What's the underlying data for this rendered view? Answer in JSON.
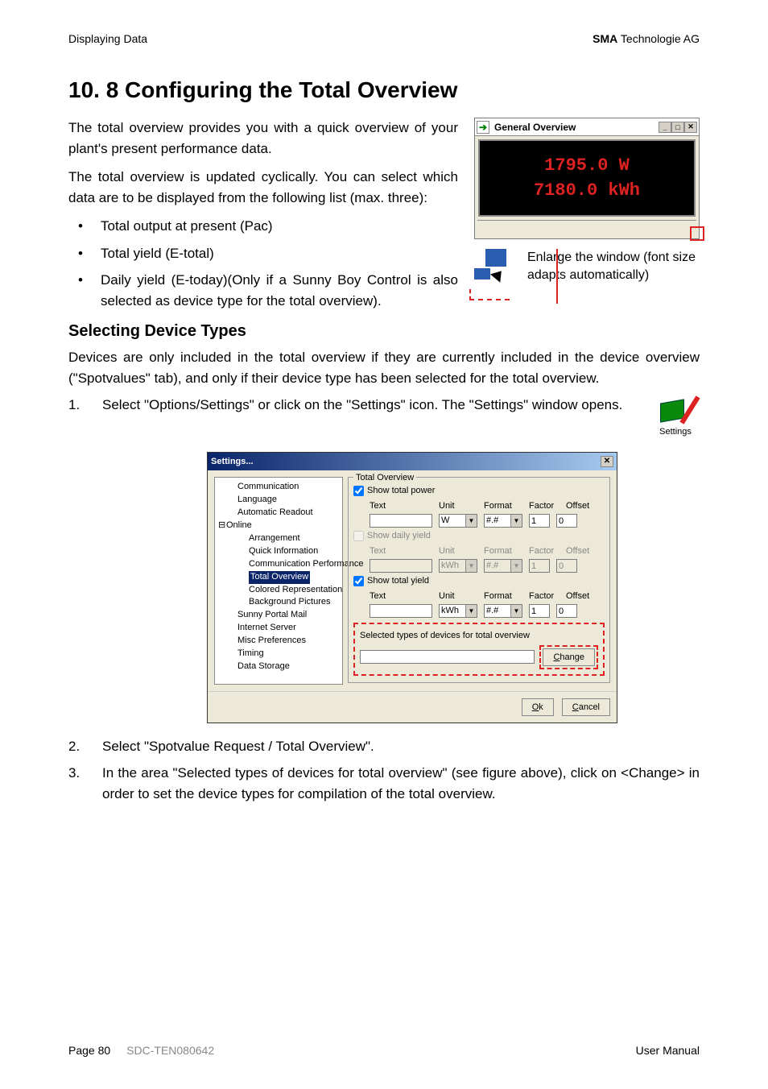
{
  "header": {
    "left": "Displaying Data",
    "right_bold": "SMA",
    "right_rest": " Technologie AG"
  },
  "title": "10. 8 Configuring the Total Overview",
  "intro": {
    "p1": "The total overview provides you with a quick overview of your plant's present performance data.",
    "p2": "The total overview is updated cyclically. You can select which data are to be displayed from the following list (max. three):",
    "bullets": [
      "Total output at present (Pac)",
      "Total yield (E-total)",
      "Daily yield (E-today)(Only if a Sunny Boy Control is also selected as device type for the total overview)."
    ]
  },
  "overview_window": {
    "title": "General Overview",
    "value1": "1795.0 W",
    "value2": "7180.0 kWh"
  },
  "callout": "Enlarge the window (font size adapts automatically)",
  "subheading": "Selecting Device Types",
  "para_devices": "Devices are only included in the total overview if they are currently included in the device overview (\"Spotvalues\" tab), and only if their device type has been selected for the total overview.",
  "steps": {
    "s1": "Select \"Options/Settings\" or click on the \"Settings\" icon. The \"Settings\" window opens.",
    "s2": "Select \"Spotvalue Request / Total Overview\".",
    "s3": "In the area \"Selected types of devices for total overview\" (see figure above), click on <Change> in order to set the device types for compilation of the total overview."
  },
  "settings_icon_caption": "Settings",
  "settings_dialog": {
    "title": "Settings...",
    "tree": {
      "items": [
        {
          "label": "Communication",
          "indent": 1
        },
        {
          "label": "Language",
          "indent": 1
        },
        {
          "label": "Automatic Readout",
          "indent": 1
        },
        {
          "label": "Online",
          "indent": 0,
          "expander": "⊟"
        },
        {
          "label": "Arrangement",
          "indent": 2
        },
        {
          "label": "Quick Information",
          "indent": 2
        },
        {
          "label": "Communication Performance",
          "indent": 2
        },
        {
          "label": "Total Overview",
          "indent": 2,
          "selected": true
        },
        {
          "label": "Colored Representation",
          "indent": 2
        },
        {
          "label": "Background Pictures",
          "indent": 2
        },
        {
          "label": "Sunny Portal Mail",
          "indent": 1
        },
        {
          "label": "Internet Server",
          "indent": 1
        },
        {
          "label": "Misc Preferences",
          "indent": 1
        },
        {
          "label": "Timing",
          "indent": 1
        },
        {
          "label": "Data Storage",
          "indent": 1
        }
      ]
    },
    "groupbox_label": "Total Overview",
    "rows": [
      {
        "checkbox_label": "Show total power",
        "checked": true,
        "enabled": true,
        "unit": "W",
        "format": "#.#",
        "factor": "1",
        "offset": "0"
      },
      {
        "checkbox_label": "Show daily yield",
        "checked": false,
        "enabled": false,
        "unit": "kWh",
        "format": "#.#",
        "factor": "1",
        "offset": "0"
      },
      {
        "checkbox_label": "Show total yield",
        "checked": true,
        "enabled": true,
        "unit": "kWh",
        "format": "#.#",
        "factor": "1",
        "offset": "0"
      }
    ],
    "col_headers": {
      "text": "Text",
      "unit": "Unit",
      "format": "Format",
      "factor": "Factor",
      "offset": "Offset"
    },
    "selected_types_label": "Selected types of devices for total overview",
    "change_btn": "Change",
    "ok_btn": "Ok",
    "cancel_btn": "Cancel"
  },
  "footer": {
    "page": "Page 80",
    "doc": "SDC-TEN080642",
    "right": "User Manual"
  }
}
